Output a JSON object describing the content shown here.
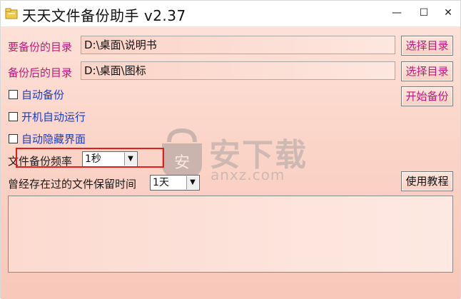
{
  "window": {
    "title": "天天文件备份助手 v2.37",
    "controls": {
      "minimize": "—",
      "maximize": "☐",
      "close": "✕"
    }
  },
  "form": {
    "source_dir_label": "要备份的目录",
    "source_dir_value": "D:\\桌面\\说明书",
    "dest_dir_label": "备份后的目录",
    "dest_dir_value": "D:\\桌面\\图标",
    "select_dir_button": "选择目录",
    "start_backup_button": "开始备份",
    "checkboxes": [
      {
        "label": "自动备份",
        "checked": false
      },
      {
        "label": "开机自动运行",
        "checked": false
      },
      {
        "label": "自动隐藏界面",
        "checked": false
      }
    ],
    "frequency_label": "文件备份频率",
    "frequency_value": "1秒",
    "retention_label": "曾经存在过的文件保留时间",
    "retention_value": "1天",
    "tutorial_button": "使用教程"
  },
  "watermark": {
    "brand": "安下载",
    "domain": "anxz.com"
  },
  "colors": {
    "accent_pink": "#c3177a",
    "label_blue": "#1b3cc6",
    "highlight_red": "#e11d1d"
  }
}
